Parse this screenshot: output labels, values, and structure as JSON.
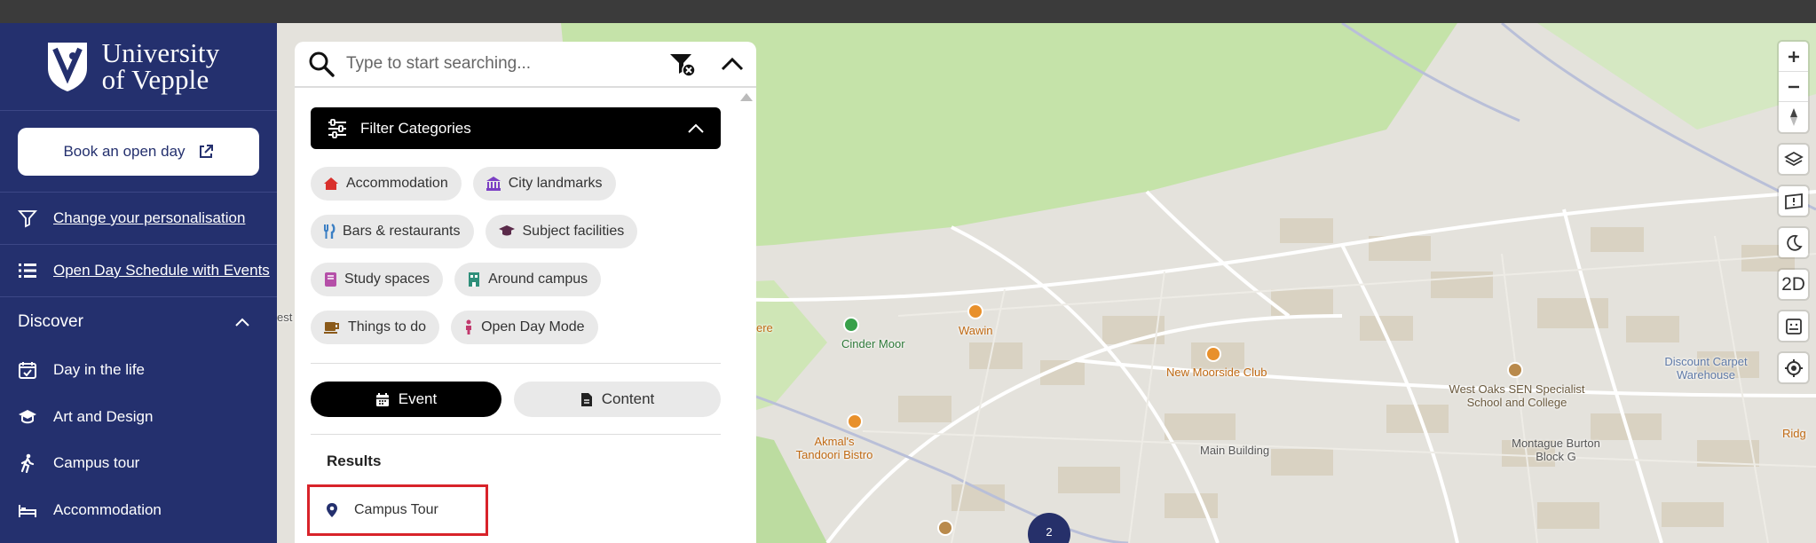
{
  "sidebar": {
    "brand": {
      "line1": "University",
      "line2": "of Vepple"
    },
    "book_button": "Book an open day",
    "links": [
      {
        "label": "Change your personalisation",
        "icon": "filter-icon"
      },
      {
        "label": "Open Day Schedule with Events",
        "icon": "list-icon"
      }
    ],
    "discover": {
      "title": "Discover",
      "items": [
        {
          "label": "Day in the life",
          "icon": "calendar-check-icon"
        },
        {
          "label": "Art and Design",
          "icon": "graduation-cap-icon"
        },
        {
          "label": "Campus tour",
          "icon": "walking-icon"
        },
        {
          "label": "Accommodation",
          "icon": "bed-icon"
        }
      ]
    }
  },
  "search": {
    "placeholder": "Type to start searching...",
    "filter_title": "Filter Categories",
    "categories": [
      {
        "label": "Accommodation",
        "icon": "house-icon",
        "color": "#d9302c"
      },
      {
        "label": "City landmarks",
        "icon": "landmark-icon",
        "color": "#7b3fc4"
      },
      {
        "label": "Bars & restaurants",
        "icon": "utensils-icon",
        "color": "#3b7fc4"
      },
      {
        "label": "Subject facilities",
        "icon": "graduation-cap-icon",
        "color": "#5a2a4a"
      },
      {
        "label": "Study spaces",
        "icon": "book-icon",
        "color": "#b54fa8"
      },
      {
        "label": "Around campus",
        "icon": "building-icon",
        "color": "#2f8f7a"
      },
      {
        "label": "Things to do",
        "icon": "coffee-icon",
        "color": "#8a5a1a"
      },
      {
        "label": "Open Day Mode",
        "icon": "person-icon",
        "color": "#c23a6e"
      }
    ],
    "tabs": {
      "event": "Event",
      "content": "Content"
    },
    "results_title": "Results",
    "results": [
      {
        "label": "Campus Tour",
        "icon": "map-pin-icon"
      }
    ]
  },
  "map": {
    "labels": {
      "cinder_moor": "Cinder Moor",
      "wawin": "Wawin",
      "new_moorside": "New Moorside Club",
      "west_oaks": "West Oaks SEN Specialist School and College",
      "discount": "Discount Carpet Warehouse",
      "akmals": "Akmal's Tandoori Bistro",
      "main_building": "Main Building",
      "montague": "Montague Burton Block G",
      "ridg": "Ridg",
      "ere": "ere",
      "est": "est"
    },
    "cluster_count": "2",
    "controls": {
      "mode_2d": "2D"
    }
  },
  "colors": {
    "sidebar_bg": "#24306e",
    "accent_red": "#d8232a",
    "map_bg": "#e4e2dc",
    "map_green": "#c5e3a9"
  }
}
